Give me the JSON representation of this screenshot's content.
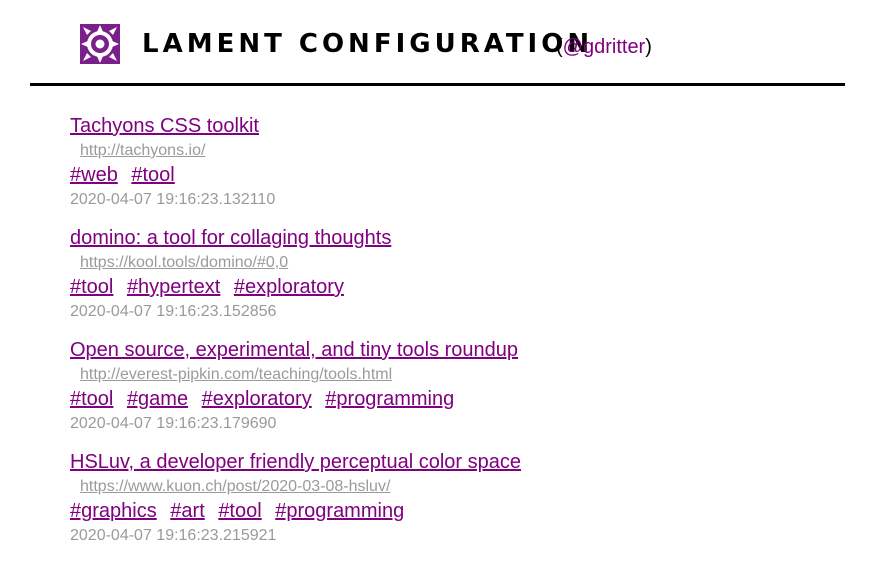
{
  "header": {
    "title": "LAMENT CONFIGURATION",
    "handle_open": "(",
    "handle_link": "@gdritter",
    "handle_close": ")",
    "logo_icon": "lament-configuration-puzzle-box-icon",
    "logo_color": "#7b1f8c"
  },
  "colors": {
    "link": "#800080",
    "muted": "#9a9a9a",
    "divider": "#000000"
  },
  "entries": [
    {
      "title": "Tachyons CSS toolkit",
      "url": "http://tachyons.io/",
      "tags": [
        "#web",
        "#tool"
      ],
      "timestamp": "2020-04-07 19:16:23.132110"
    },
    {
      "title": "domino: a tool for collaging thoughts",
      "url": "https://kool.tools/domino/#0,0",
      "tags": [
        "#tool",
        "#hypertext",
        "#exploratory"
      ],
      "timestamp": "2020-04-07 19:16:23.152856"
    },
    {
      "title": "Open source, experimental, and tiny tools roundup",
      "url": "http://everest-pipkin.com/teaching/tools.html",
      "tags": [
        "#tool",
        "#game",
        "#exploratory",
        "#programming"
      ],
      "timestamp": "2020-04-07 19:16:23.179690"
    },
    {
      "title": "HSLuv, a developer friendly perceptual color space",
      "url": "https://www.kuon.ch/post/2020-03-08-hsluv/",
      "tags": [
        "#graphics",
        "#art",
        "#tool",
        "#programming"
      ],
      "timestamp": "2020-04-07 19:16:23.215921"
    }
  ]
}
